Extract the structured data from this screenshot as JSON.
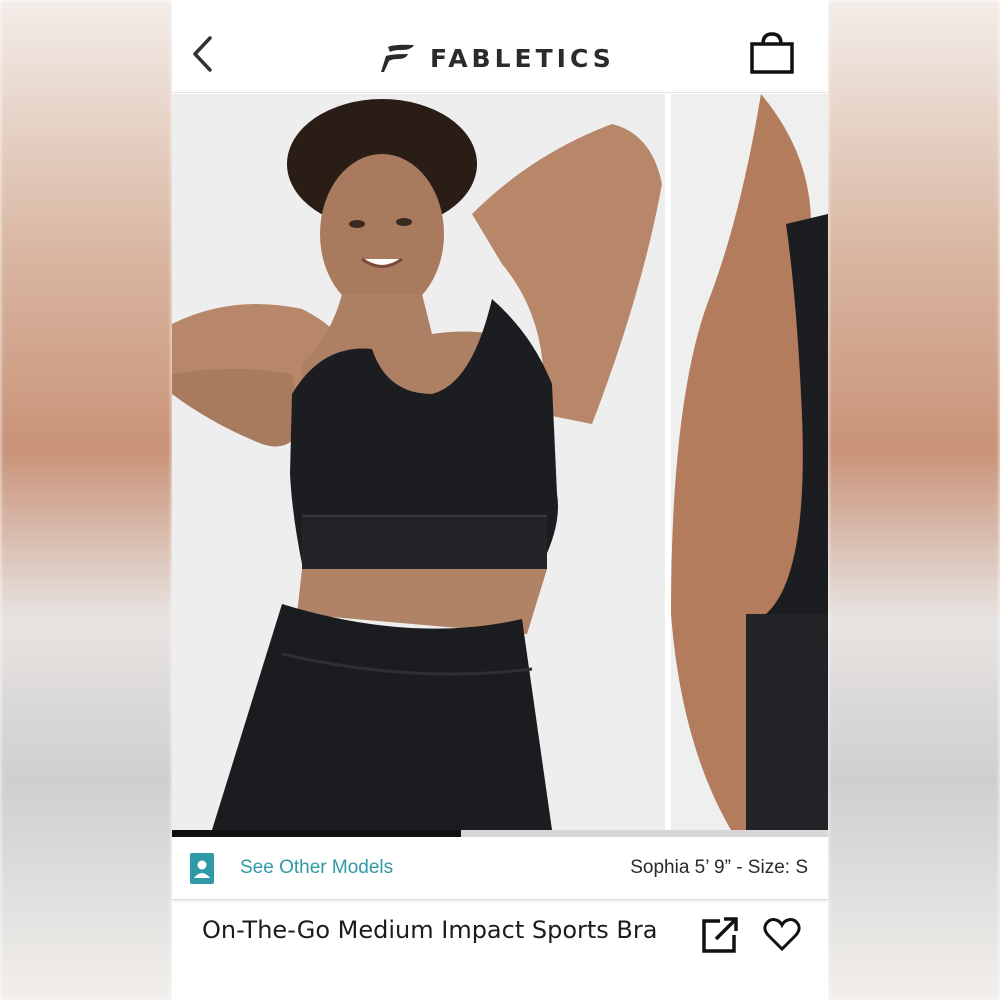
{
  "header": {
    "brand": "FABLETICS",
    "back_icon": "chevron-left-icon",
    "bag_icon": "shopping-bag-icon"
  },
  "gallery": {
    "image_index": 1,
    "progress_fraction": 0.44,
    "main_image": "model-front-photo",
    "next_image": "model-back-detail-photo"
  },
  "models": {
    "see_other_label": "See Other Models",
    "model_info": "Sophia 5’ 9” - Size: S",
    "accent_color": "#2f9aa5"
  },
  "product": {
    "name": "On-The-Go Medium Impact Sports Bra",
    "share_icon": "share-external-icon",
    "wishlist_icon": "heart-icon"
  }
}
